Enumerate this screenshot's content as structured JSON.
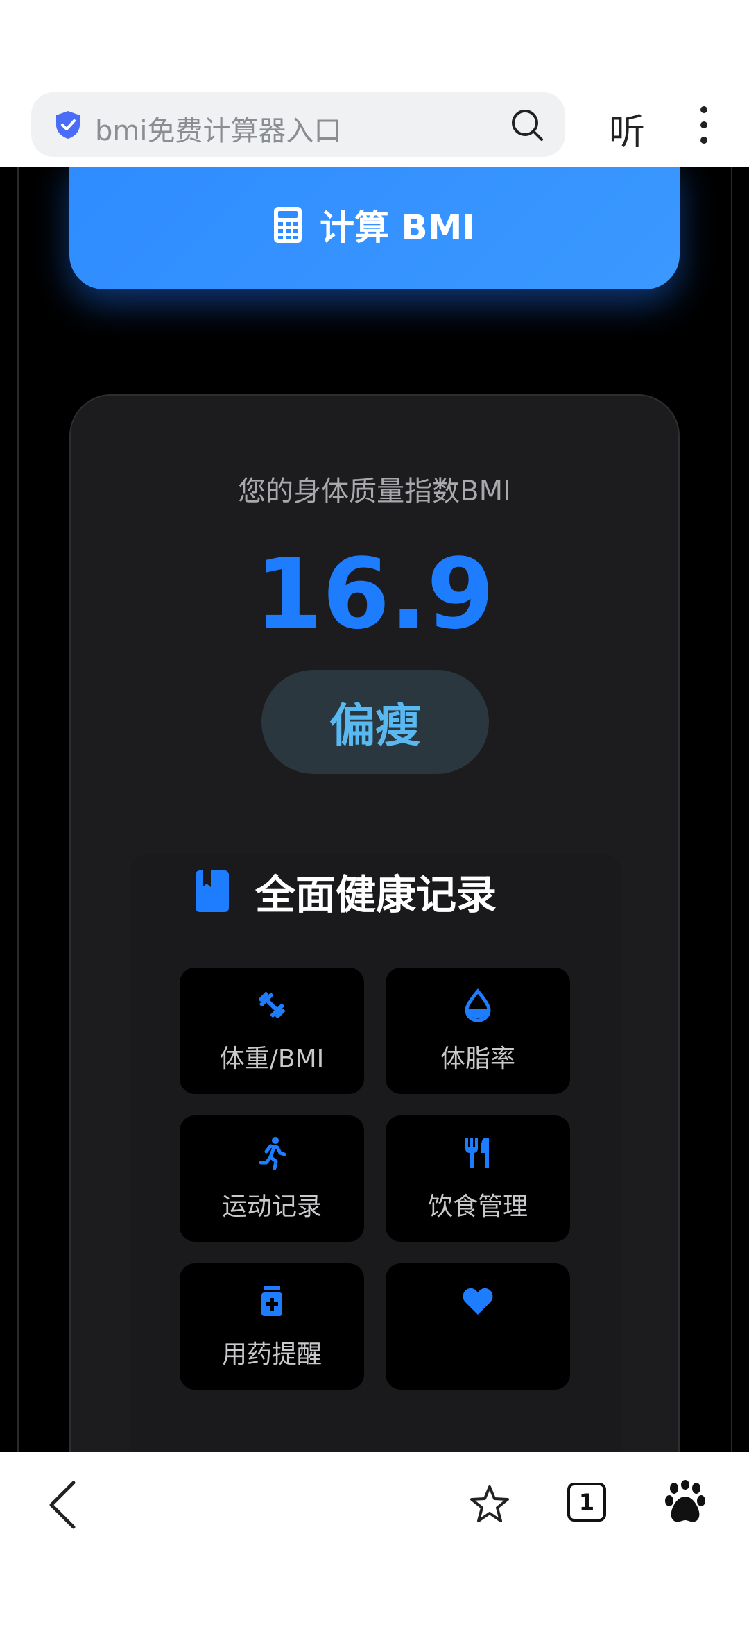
{
  "browser": {
    "search_text": "bmi免费计算器入口",
    "listen_label": "听",
    "tab_count": "1"
  },
  "calculator": {
    "button_label": "计算 BMI"
  },
  "result": {
    "title": "您的身体质量指数BMI",
    "value": "16.9",
    "status": "偏瘦",
    "accent_color": "#1e7dff",
    "status_color": "#5ab8f0"
  },
  "health": {
    "title": "全面健康记录",
    "tiles": [
      {
        "label": "体重/BMI",
        "icon": "dumbbell-icon"
      },
      {
        "label": "体脂率",
        "icon": "drop-icon"
      },
      {
        "label": "运动记录",
        "icon": "running-icon"
      },
      {
        "label": "饮食管理",
        "icon": "utensils-icon"
      },
      {
        "label": "用药提醒",
        "icon": "medicine-icon"
      },
      {
        "label": "",
        "icon": "heart-icon"
      }
    ]
  }
}
